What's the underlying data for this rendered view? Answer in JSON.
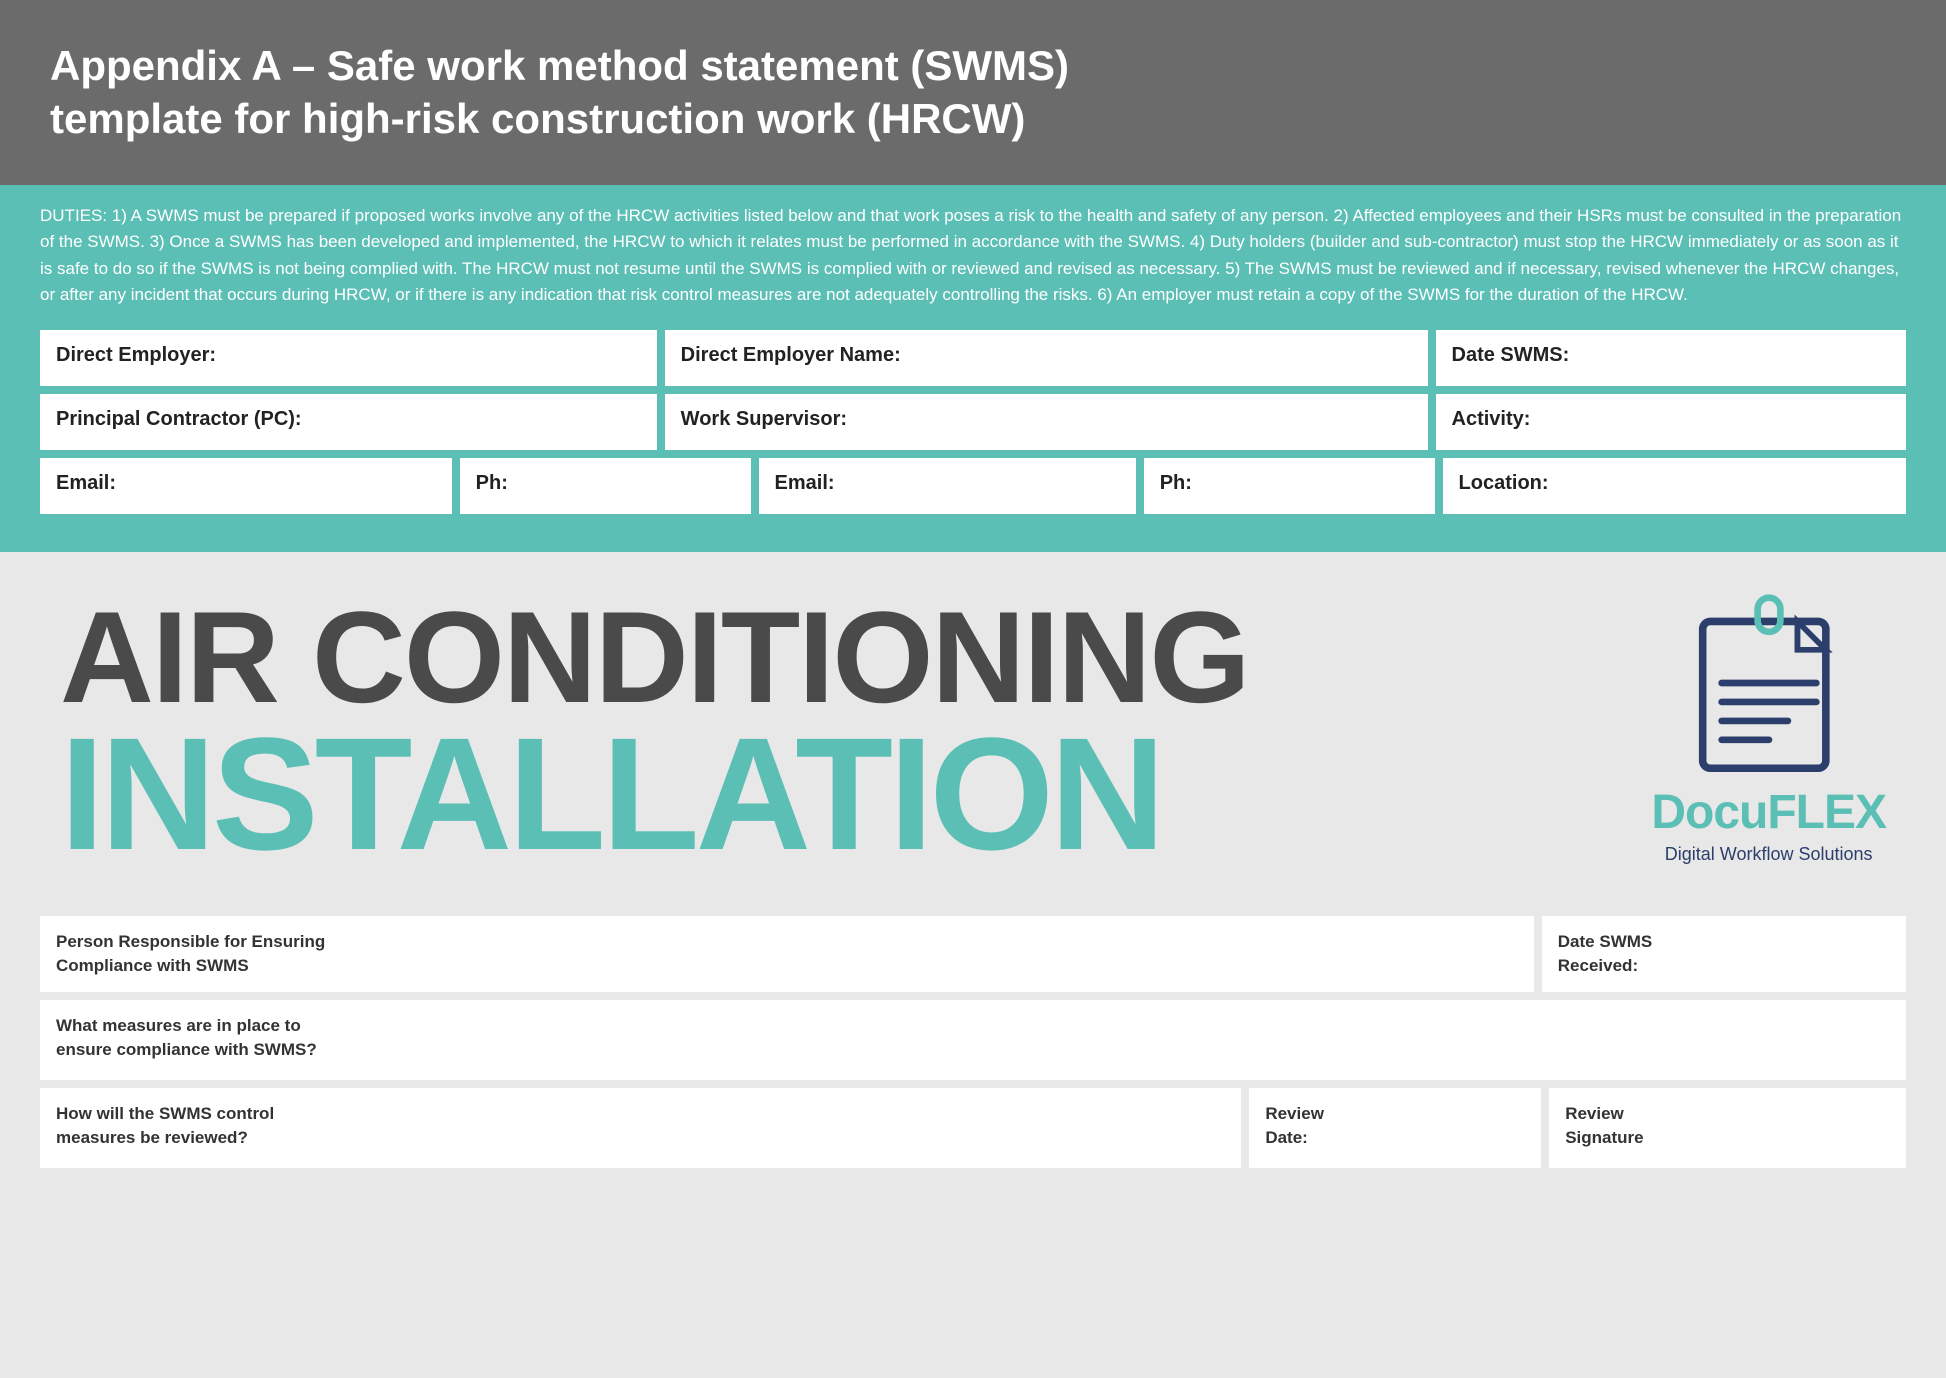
{
  "header": {
    "title": "Appendix A – Safe work method statement (SWMS)\ntemplate for high-risk construction work (HRCW)"
  },
  "duties": {
    "text": "DUTIES: 1) A SWMS must be prepared if proposed works involve any of the HRCW activities listed below and that work poses a risk to the health and safety of any person. 2) Affected employees and their HSRs must be consulted in the preparation of the SWMS. 3) Once a SWMS has been developed and implemented, the HRCW to which it relates must be performed in accordance with the SWMS. 4) Duty holders (builder and sub-contractor) must stop the HRCW immediately or as soon as it is safe to do so if the SWMS is not being complied with. The HRCW must not resume until the SWMS is complied with or reviewed and revised as necessary. 5) The SWMS must be reviewed and if necessary, revised whenever the HRCW changes, or after any incident that occurs during HRCW, or if there is any indication that risk control measures are not adequately controlling the risks. 6) An employer must retain a copy of the SWMS for the duration of the HRCW."
  },
  "form_row1": [
    {
      "label": "Direct Employer:"
    },
    {
      "label": "Direct Employer Name:"
    },
    {
      "label": "Date SWMS:"
    }
  ],
  "form_row2": [
    {
      "label": "Principal Contractor (PC):"
    },
    {
      "label": "Work Supervisor:"
    },
    {
      "label": "Activity:"
    }
  ],
  "form_row3": [
    {
      "label": "Email:"
    },
    {
      "label": "Ph:"
    },
    {
      "label": "Email:"
    },
    {
      "label": "Ph:"
    },
    {
      "label": "Location:"
    }
  ],
  "ac_banner": {
    "title_dark": "AIR CONDITIONING",
    "title_teal": "INSTALLATION"
  },
  "logo": {
    "name_dark": "Docu",
    "name_teal": "FLEX",
    "subtitle": "Digital Workflow Solutions"
  },
  "bottom_form": {
    "row1": [
      {
        "label": "Person Responsible for Ensuring\nCompliance with SWMS",
        "span": "wide"
      },
      {
        "label": "Date SWMS\nReceived:",
        "span": "narrow"
      }
    ],
    "row2": [
      {
        "label": "What measures are in place to\nensure compliance with SWMS?",
        "span": "full"
      }
    ],
    "row3": [
      {
        "label": "How will the SWMS control\nmeasures be reviewed?",
        "span": "wide"
      },
      {
        "label": "Review\nDate:",
        "span": "medium"
      },
      {
        "label": "Review\nSignature",
        "span": "medium"
      }
    ]
  }
}
